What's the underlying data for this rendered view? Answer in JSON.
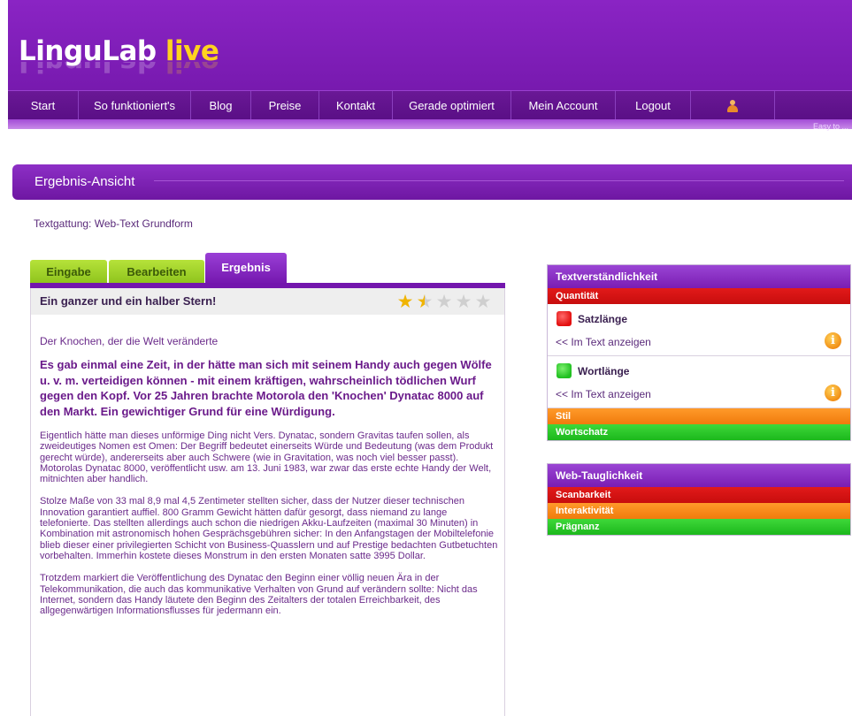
{
  "header": {
    "logo_main": "LinguLab",
    "logo_accent": "live",
    "corner_link": "Easy to ...",
    "nav": [
      {
        "label": "Start"
      },
      {
        "label": "So funktioniert's"
      },
      {
        "label": "Blog"
      },
      {
        "label": "Preise"
      },
      {
        "label": "Kontakt"
      },
      {
        "label": "Gerade optimiert"
      },
      {
        "label": "Mein Account"
      },
      {
        "label": "Logout"
      }
    ],
    "user_icon": "user-icon"
  },
  "page": {
    "title": "Ergebnis-Ansicht",
    "genre": "Textgattung: Web-Text Grundform"
  },
  "tabs": [
    {
      "label": "Eingabe"
    },
    {
      "label": "Bearbeiten"
    },
    {
      "label": "Ergebnis",
      "active": true
    }
  ],
  "result": {
    "rating_text": "Ein ganzer und ein halber Stern!",
    "rating_value": 1.5,
    "rating_max": 5
  },
  "article": {
    "kicker": "Der Knochen, der die Welt veränderte",
    "lead": "Es gab einmal eine Zeit, in der hätte man sich mit seinem Handy auch gegen Wölfe u. v. m. verteidigen können - mit einem kräftigen, wahrscheinlich tödlichen Wurf gegen den Kopf. Vor 25 Jahren brachte Motorola den 'Knochen' Dynatac 8000 auf den Markt. Ein gewichtiger Grund für eine Würdigung.",
    "paragraphs": [
      "Eigentlich hätte man dieses unförmige Ding nicht Vers. Dynatac, sondern Gravitas taufen sollen, als zweideutiges Nomen est Omen: Der Begriff bedeutet einerseits Würde und Bedeutung (was dem Produkt gerecht würde), andererseits aber auch Schwere (wie in Gravitation, was noch viel besser passt). Motorolas Dynatac 8000, veröffentlicht usw. am 13. Juni 1983, war zwar das erste echte Handy der Welt, mitnichten aber handlich.",
      "Stolze Maße von 33 mal 8,9 mal 4,5 Zentimeter stellten sicher, dass der Nutzer dieser technischen Innovation garantiert auffiel. 800 Gramm Gewicht hätten dafür gesorgt, dass niemand zu lange telefonierte. Das stellten allerdings auch schon die niedrigen Akku-Laufzeiten (maximal 30 Minuten) in Kombination mit astronomisch hohen Gesprächsgebühren sicher: In den Anfangstagen der Mobiltelefonie blieb dieser einer privilegierten Schicht von Business-Quasslern und auf Prestige bedachten Gutbetuchten vorbehalten. Immerhin kostete dieses Monstrum in den ersten Monaten satte 3995 Dollar.",
      "Trotzdem markiert die Veröffentlichung des Dynatac den Beginn einer völlig neuen Ära in der Telekommunikation, die auch das kommunikative Verhalten von Grund auf verändern sollte: Nicht das Internet, sondern das Handy läutete den Beginn des Zeitalters der totalen Erreichbarkeit, des allgegenwärtigen Informationsflusses für jedermann ein."
    ]
  },
  "panel_textverstaendlichkeit": {
    "title": "Textverständlichkeit",
    "quantitaet": "Quantität",
    "satzlaenge": {
      "name": "Satzlänge",
      "status": "red",
      "link": "<< Im Text anzeigen"
    },
    "wortlaenge": {
      "name": "Wortlänge",
      "status": "green",
      "link": "<< Im Text anzeigen"
    },
    "stil": "Stil",
    "wortschatz": "Wortschatz"
  },
  "panel_web": {
    "title": "Web-Tauglichkeit",
    "scanbarkeit": "Scanbarkeit",
    "interaktivitaet": "Interaktivität",
    "praegnanz": "Prägnanz"
  },
  "colors": {
    "brand_purple": "#7a1bb2",
    "accent_yellow": "#ffd21f",
    "status_red": "#d51414",
    "status_orange": "#f5860f",
    "status_green": "#26c026",
    "tab_green": "#9fd22a"
  },
  "icons": {
    "info": "info-icon",
    "star": "star-icon"
  }
}
